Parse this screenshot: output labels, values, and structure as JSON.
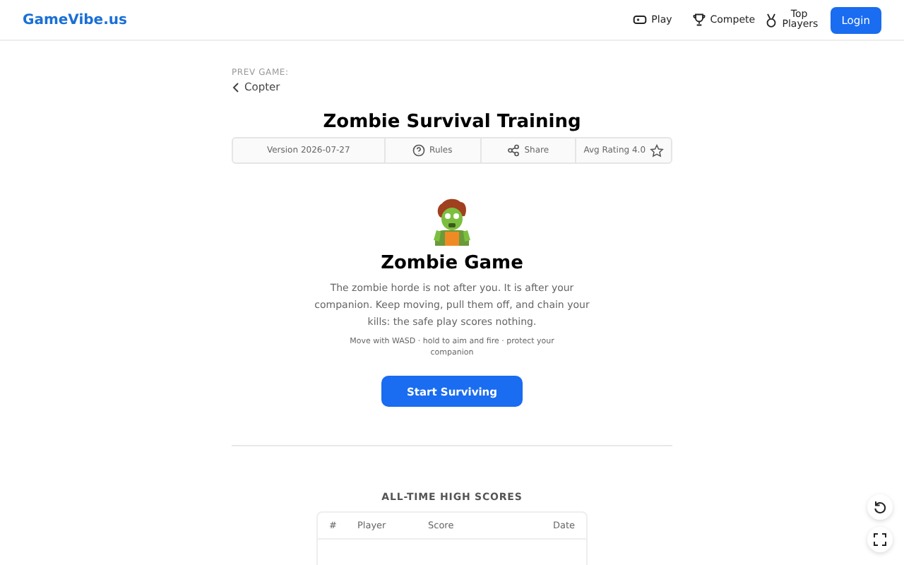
{
  "header": {
    "logo": "GameVibe.us",
    "nav": [
      {
        "label": "Play"
      },
      {
        "label": "Compete"
      },
      {
        "label": "Top Players"
      }
    ],
    "login": "Login"
  },
  "prev": {
    "caption": "PREV GAME:",
    "link": "Copter"
  },
  "title": "Zombie Survival Training",
  "info": [
    {
      "kind": "text",
      "label": "Version 2026-07-27"
    },
    {
      "kind": "rules",
      "label": "Rules"
    },
    {
      "kind": "share",
      "label": "Share"
    },
    {
      "kind": "rating",
      "label": "Avg Rating 4.0"
    }
  ],
  "game": {
    "name": "Zombie Game",
    "description": "The zombie horde is not after you. It is after your companion. Keep moving, pull them off, and chain your kills: the safe play scores nothing.",
    "controls": "Move with WASD · hold to aim and fire · protect your companion",
    "start": "Start Surviving"
  },
  "scores": {
    "title": "ALL-TIME HIGH SCORES",
    "columns": [
      "#",
      "Player",
      "Score",
      "Date"
    ]
  }
}
